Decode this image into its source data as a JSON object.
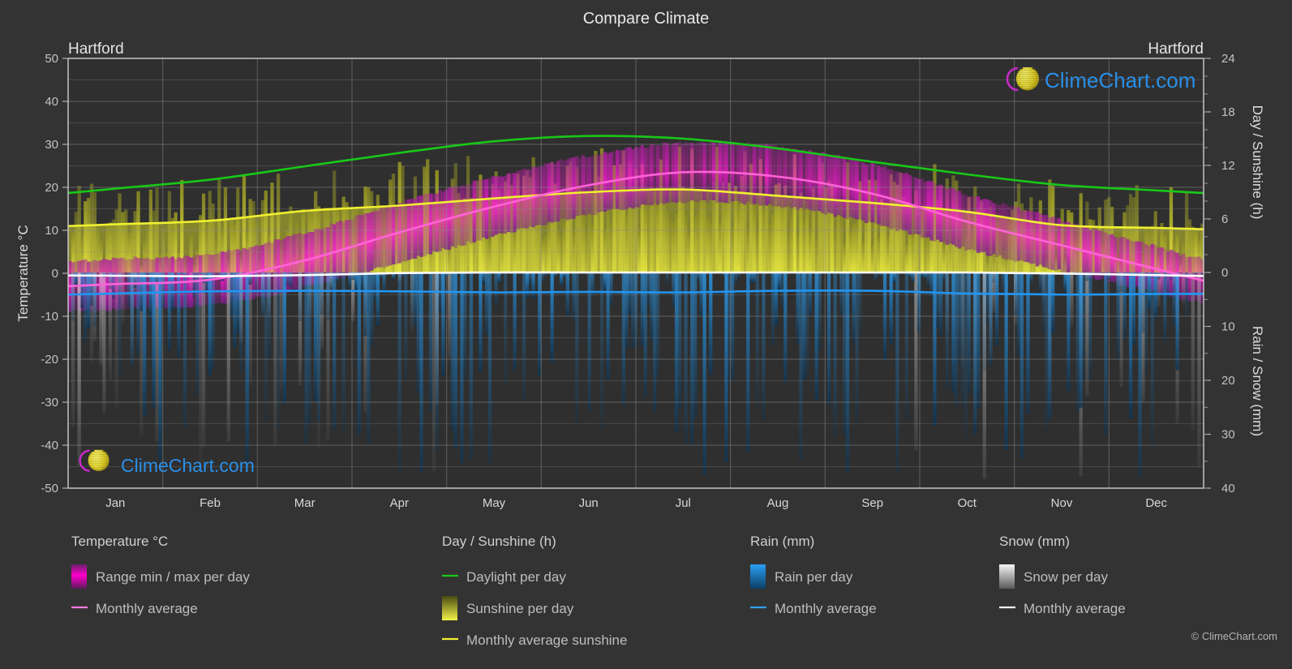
{
  "header": {
    "title": "Compare Climate",
    "city_left": "Hartford",
    "city_right": "Hartford"
  },
  "branding": {
    "logo_text": "ClimeChart.com",
    "copyright": "© ClimeChart.com"
  },
  "axes": {
    "left": {
      "title": "Temperature °C",
      "ticks": [
        "50",
        "40",
        "30",
        "20",
        "10",
        "0",
        "-10",
        "-20",
        "-30",
        "-40",
        "-50"
      ],
      "min": -50,
      "max": 50
    },
    "right_top": {
      "title": "Day / Sunshine (h)",
      "ticks": [
        "24",
        "18",
        "12",
        "6",
        "0"
      ],
      "min": 0,
      "max": 24
    },
    "right_bottom": {
      "title": "Rain / Snow (mm)",
      "ticks": [
        "0",
        "10",
        "20",
        "30",
        "40"
      ],
      "min": 0,
      "max": 40
    },
    "x": {
      "months": [
        "Jan",
        "Feb",
        "Mar",
        "Apr",
        "May",
        "Jun",
        "Jul",
        "Aug",
        "Sep",
        "Oct",
        "Nov",
        "Dec"
      ]
    }
  },
  "legend": {
    "groups": [
      {
        "heading": "Temperature °C",
        "items": [
          {
            "label": "Range min / max per day",
            "marker": "gradient-swatch",
            "color": "#ff00cc"
          },
          {
            "label": "Monthly average",
            "marker": "line",
            "color": "#ff7ae0"
          }
        ]
      },
      {
        "heading": "Day / Sunshine (h)",
        "items": [
          {
            "label": "Daylight per day",
            "marker": "line",
            "color": "#18c818"
          },
          {
            "label": "Sunshine per day",
            "marker": "gradient-swatch",
            "color": "#eaea28"
          },
          {
            "label": "Monthly average sunshine",
            "marker": "line",
            "color": "#f0f030"
          }
        ]
      },
      {
        "heading": "Rain (mm)",
        "items": [
          {
            "label": "Rain per day",
            "marker": "gradient-swatch",
            "color": "#1388e0"
          },
          {
            "label": "Monthly average",
            "marker": "line",
            "color": "#30a0ee"
          }
        ]
      },
      {
        "heading": "Snow (mm)",
        "items": [
          {
            "label": "Snow per day",
            "marker": "gradient-swatch",
            "color": "#cfcfcf"
          },
          {
            "label": "Monthly average",
            "marker": "line",
            "color": "#f2f2f2"
          }
        ]
      }
    ]
  },
  "colors": {
    "background": "#333333",
    "plot_background": "#2f2f2f",
    "grid": "#8a8a8a",
    "daylight": "#18c818",
    "sunshine_line": "#f0f030",
    "sunshine_fill": "#b9b92e",
    "temp_range": "#d321c0",
    "temp_avg": "#ff63d8",
    "rain_fill": "#1a6ea8",
    "rain_avg": "#2196f3",
    "snow_fill": "#9a9a9a",
    "snow_avg": "#ffffff"
  },
  "chart_data": {
    "type": "line",
    "title": "Compare Climate",
    "subtitle": "Hartford",
    "xlabel": "",
    "ylabel": "Temperature °C",
    "grid": true,
    "legend_position": "bottom",
    "categories": [
      "Jan",
      "Feb",
      "Mar",
      "Apr",
      "May",
      "Jun",
      "Jul",
      "Aug",
      "Sep",
      "Oct",
      "Nov",
      "Dec"
    ],
    "axis_left": {
      "label": "Temperature °C",
      "min": -50,
      "max": 50,
      "step": 10
    },
    "axis_right_top": {
      "label": "Day / Sunshine (h)",
      "min": 0,
      "max": 24,
      "step": 6
    },
    "axis_right_bottom": {
      "label": "Rain / Snow (mm)",
      "min": 0,
      "max": 40,
      "step": 10
    },
    "series": [
      {
        "name": "Monthly average temperature",
        "unit": "°C",
        "axis": "left",
        "color": "#ff63d8",
        "values": [
          -2.5,
          -1.5,
          3.0,
          9.5,
          15.5,
          20.5,
          23.5,
          22.5,
          18.5,
          12.0,
          6.5,
          1.0
        ]
      },
      {
        "name": "Daylight per day",
        "unit": "h",
        "axis": "right_top",
        "color": "#18c818",
        "values": [
          9.4,
          10.4,
          11.9,
          13.4,
          14.7,
          15.3,
          15.0,
          13.9,
          12.4,
          11.0,
          9.8,
          9.2
        ]
      },
      {
        "name": "Monthly average sunshine",
        "unit": "h",
        "axis": "right_top",
        "color": "#f0f030",
        "values": [
          5.4,
          5.8,
          6.9,
          7.5,
          8.3,
          9.0,
          9.3,
          8.6,
          7.8,
          6.8,
          5.3,
          5.0
        ]
      },
      {
        "name": "Monthly average rain",
        "unit": "mm",
        "axis": "right_bottom",
        "color": "#2196f3",
        "values": [
          3.9,
          3.5,
          3.4,
          3.5,
          3.7,
          3.6,
          3.7,
          3.4,
          3.4,
          3.9,
          4.1,
          4.0
        ]
      },
      {
        "name": "Monthly average snow",
        "unit": "mm",
        "axis": "right_bottom",
        "color": "#ffffff",
        "values": [
          0.6,
          0.7,
          0.5,
          0.1,
          0.0,
          0.0,
          0.0,
          0.0,
          0.0,
          0.0,
          0.2,
          0.5
        ]
      },
      {
        "name": "Temperature range max per day",
        "unit": "°C",
        "axis": "left",
        "color": "#d321c0",
        "values": [
          3.0,
          4.0,
          9.0,
          16.0,
          22.0,
          27.0,
          30.0,
          29.0,
          25.0,
          18.0,
          12.0,
          6.0
        ]
      },
      {
        "name": "Temperature range min per day",
        "unit": "°C",
        "axis": "left",
        "color": "#d321c0",
        "values": [
          -8.0,
          -7.0,
          -3.0,
          3.0,
          9.0,
          14.0,
          17.0,
          16.0,
          12.0,
          6.0,
          1.0,
          -4.0
        ]
      },
      {
        "name": "Sunshine per day",
        "unit": "h",
        "axis": "right_top",
        "color": "#b9b92e",
        "values": [
          5.4,
          5.8,
          6.9,
          7.5,
          8.3,
          9.0,
          9.3,
          8.6,
          7.8,
          6.8,
          5.3,
          5.0
        ]
      }
    ]
  }
}
